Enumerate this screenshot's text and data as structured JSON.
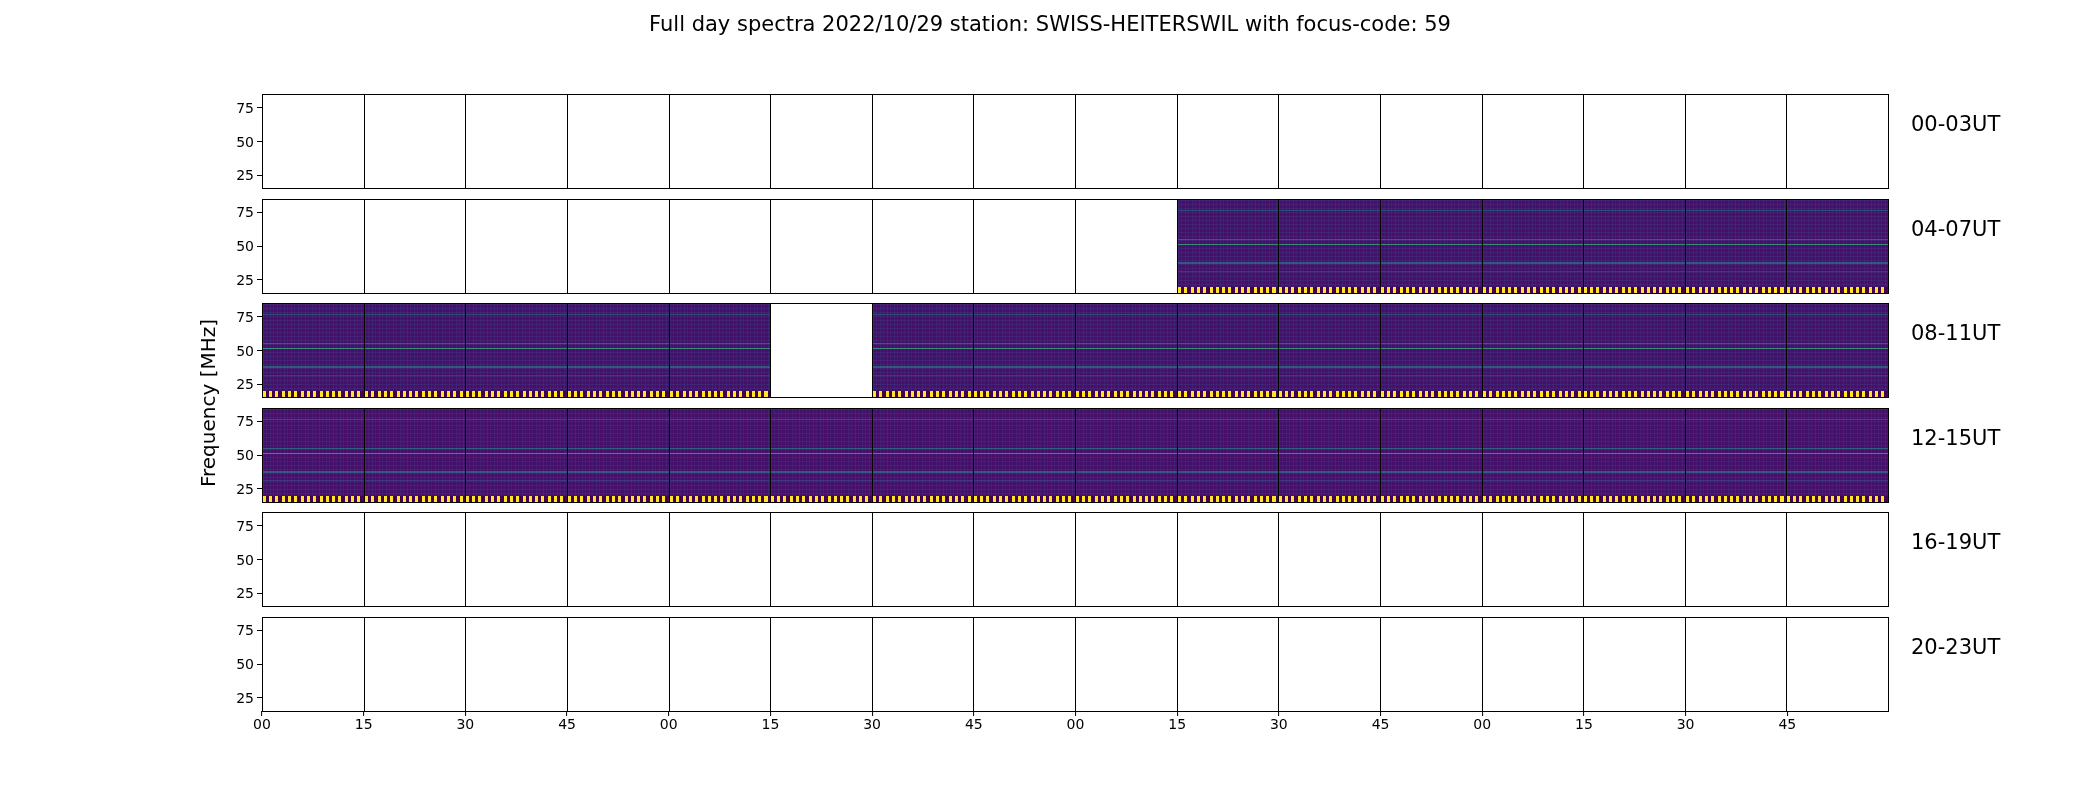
{
  "title": "Full day spectra 2022/10/29 station: SWISS-HEITERSWIL with focus-code: 59",
  "ylabel": "Frequency [MHz]",
  "rows": [
    {
      "label": "00-03UT",
      "yticks": [
        "75",
        "50",
        "25"
      ],
      "panels": [
        {
          "kind": "empty"
        },
        {
          "kind": "empty"
        },
        {
          "kind": "empty"
        },
        {
          "kind": "empty"
        },
        {
          "kind": "empty"
        },
        {
          "kind": "empty"
        },
        {
          "kind": "empty"
        },
        {
          "kind": "empty"
        },
        {
          "kind": "empty"
        },
        {
          "kind": "empty"
        },
        {
          "kind": "empty"
        },
        {
          "kind": "empty"
        },
        {
          "kind": "empty"
        },
        {
          "kind": "empty"
        },
        {
          "kind": "empty"
        },
        {
          "kind": "empty"
        }
      ]
    },
    {
      "label": "04-07UT",
      "yticks": [
        "75",
        "50",
        "25"
      ],
      "panels": [
        {
          "kind": "empty"
        },
        {
          "kind": "empty"
        },
        {
          "kind": "empty"
        },
        {
          "kind": "empty"
        },
        {
          "kind": "empty"
        },
        {
          "kind": "empty"
        },
        {
          "kind": "empty"
        },
        {
          "kind": "empty"
        },
        {
          "kind": "empty"
        },
        {
          "kind": "spectrum"
        },
        {
          "kind": "spectrum"
        },
        {
          "kind": "spectrum"
        },
        {
          "kind": "spectrum"
        },
        {
          "kind": "spectrum"
        },
        {
          "kind": "spectrum"
        },
        {
          "kind": "spectrum"
        }
      ]
    },
    {
      "label": "08-11UT",
      "yticks": [
        "75",
        "50",
        "25"
      ],
      "panels": [
        {
          "kind": "spectrum"
        },
        {
          "kind": "spectrum"
        },
        {
          "kind": "spectrum"
        },
        {
          "kind": "spectrum"
        },
        {
          "kind": "spectrum"
        },
        {
          "kind": "empty"
        },
        {
          "kind": "spectrum"
        },
        {
          "kind": "spectrum"
        },
        {
          "kind": "spectrum"
        },
        {
          "kind": "spectrum"
        },
        {
          "kind": "spectrum"
        },
        {
          "kind": "spectrum"
        },
        {
          "kind": "spectrum"
        },
        {
          "kind": "spectrum"
        },
        {
          "kind": "spectrum"
        },
        {
          "kind": "spectrum"
        }
      ]
    },
    {
      "label": "12-15UT",
      "yticks": [
        "75",
        "50",
        "25"
      ],
      "panels": [
        {
          "kind": "spectrum"
        },
        {
          "kind": "spectrum"
        },
        {
          "kind": "spectrum"
        },
        {
          "kind": "spectrum"
        },
        {
          "kind": "spectrum"
        },
        {
          "kind": "spectrum"
        },
        {
          "kind": "spectrum"
        },
        {
          "kind": "spectrum"
        },
        {
          "kind": "spectrum"
        },
        {
          "kind": "spectrum"
        },
        {
          "kind": "spectrum"
        },
        {
          "kind": "spectrum"
        },
        {
          "kind": "spectrum"
        },
        {
          "kind": "spectrum"
        },
        {
          "kind": "spectrum"
        },
        {
          "kind": "spectrum"
        }
      ]
    },
    {
      "label": "16-19UT",
      "yticks": [
        "75",
        "50",
        "25"
      ],
      "panels": [
        {
          "kind": "empty"
        },
        {
          "kind": "empty"
        },
        {
          "kind": "empty"
        },
        {
          "kind": "empty"
        },
        {
          "kind": "empty"
        },
        {
          "kind": "empty"
        },
        {
          "kind": "empty"
        },
        {
          "kind": "empty"
        },
        {
          "kind": "empty"
        },
        {
          "kind": "empty"
        },
        {
          "kind": "empty"
        },
        {
          "kind": "empty"
        },
        {
          "kind": "empty"
        },
        {
          "kind": "empty"
        },
        {
          "kind": "empty"
        },
        {
          "kind": "empty"
        }
      ]
    },
    {
      "label": "20-23UT",
      "yticks": [
        "75",
        "50",
        "25"
      ],
      "panels": [
        {
          "kind": "empty"
        },
        {
          "kind": "empty"
        },
        {
          "kind": "empty"
        },
        {
          "kind": "empty"
        },
        {
          "kind": "empty"
        },
        {
          "kind": "empty"
        },
        {
          "kind": "empty"
        },
        {
          "kind": "empty"
        },
        {
          "kind": "empty"
        },
        {
          "kind": "empty"
        },
        {
          "kind": "empty"
        },
        {
          "kind": "empty"
        },
        {
          "kind": "empty"
        },
        {
          "kind": "empty"
        },
        {
          "kind": "empty"
        },
        {
          "kind": "empty"
        }
      ]
    }
  ],
  "xticks": [
    "00",
    "15",
    "30",
    "45",
    "00",
    "15",
    "30",
    "45",
    "00",
    "15",
    "30",
    "45",
    "00",
    "15",
    "30",
    "45"
  ]
}
